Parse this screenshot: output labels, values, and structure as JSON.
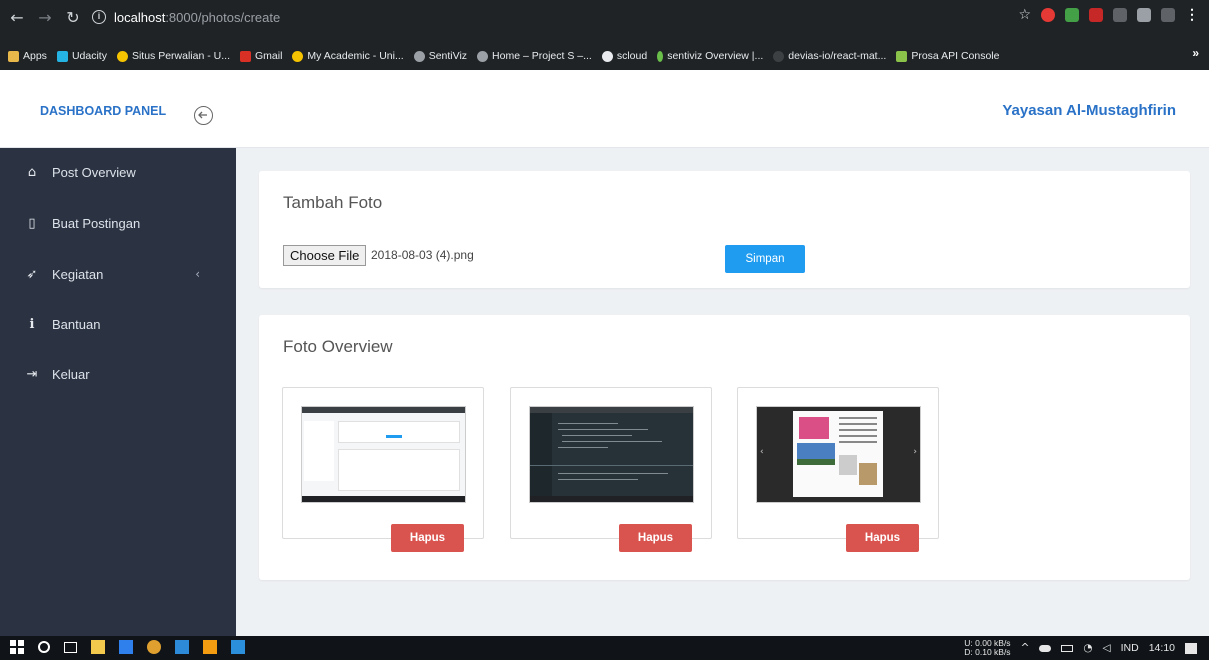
{
  "browser": {
    "url_host": "localhost",
    "url_path": ":8000/photos/create",
    "bookmarks": [
      {
        "label": "Apps",
        "color": "#e8b84a"
      },
      {
        "label": "Udacity",
        "color": "#25b3e3"
      },
      {
        "label": "Situs Perwalian - U...",
        "color": "#f5c300"
      },
      {
        "label": "Gmail",
        "color": "#d93025"
      },
      {
        "label": "My Academic - Uni...",
        "color": "#f5c300"
      },
      {
        "label": "SentiViz",
        "color": "#9aa0a6"
      },
      {
        "label": "Home – Project S –...",
        "color": "#9aa0a6"
      },
      {
        "label": "scloud",
        "color": "#e8eaed"
      },
      {
        "label": "sentiviz Overview |...",
        "color": "#6abf4b"
      },
      {
        "label": "devias-io/react-mat...",
        "color": "#3c4043"
      },
      {
        "label": "Prosa API Console",
        "color": "#8bc34a"
      }
    ],
    "more": "»"
  },
  "header": {
    "brand": "DASHBOARD PANEL",
    "org": "Yayasan Al-Mustaghfirin"
  },
  "sidebar": {
    "items": [
      {
        "label": "Post Overview",
        "icon": "⌂"
      },
      {
        "label": "Buat Postingan",
        "icon": "▯"
      },
      {
        "label": "Kegiatan",
        "icon": "➶",
        "caret": "‹"
      },
      {
        "label": "Bantuan",
        "icon": "i"
      },
      {
        "label": "Keluar",
        "icon": "⇥"
      }
    ]
  },
  "upload": {
    "title": "Tambah Foto",
    "choose_label": "Choose File",
    "file_name": "2018-08-03 (4).png",
    "save_label": "Simpan"
  },
  "overview": {
    "title": "Foto Overview",
    "delete_label": "Hapus"
  },
  "taskbar": {
    "net_up": "0.00 kB/s",
    "net_down": "0.10 kB/s",
    "net_u": "U:",
    "net_d": "D:",
    "lang": "IND",
    "time": "14:10"
  },
  "colors": {
    "accent": "#2a72c7",
    "save": "#1f9cf0",
    "delete": "#d9534f",
    "sidebar": "#2b3342"
  }
}
